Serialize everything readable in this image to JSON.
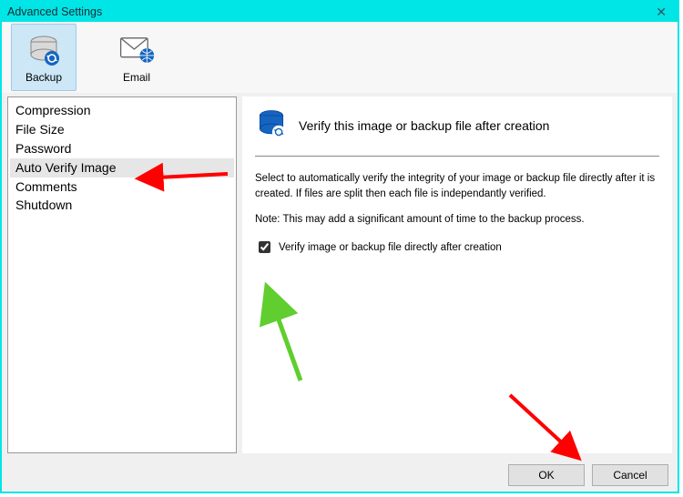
{
  "window": {
    "title": "Advanced Settings"
  },
  "toolbar": {
    "backup_label": "Backup",
    "email_label": "Email"
  },
  "left_list": {
    "items": [
      "Compression",
      "File Size",
      "Password",
      "Auto Verify Image",
      "Comments",
      "Shutdown"
    ],
    "selected_index": 3
  },
  "right": {
    "title": "Verify this image or backup file after creation",
    "desc1": "Select to automatically verify the integrity of your image or backup file directly after it is created. If files are split then each file is independantly verified.",
    "desc2": "Note: This may add a significant amount of time to the backup process.",
    "checkbox_label": "Verify image or backup file directly after creation",
    "checkbox_checked": true
  },
  "footer": {
    "ok_label": "OK",
    "cancel_label": "Cancel"
  },
  "colors": {
    "accent": "#00e5e5",
    "arrow_red": "#ff0000",
    "arrow_green": "#66dd33"
  }
}
